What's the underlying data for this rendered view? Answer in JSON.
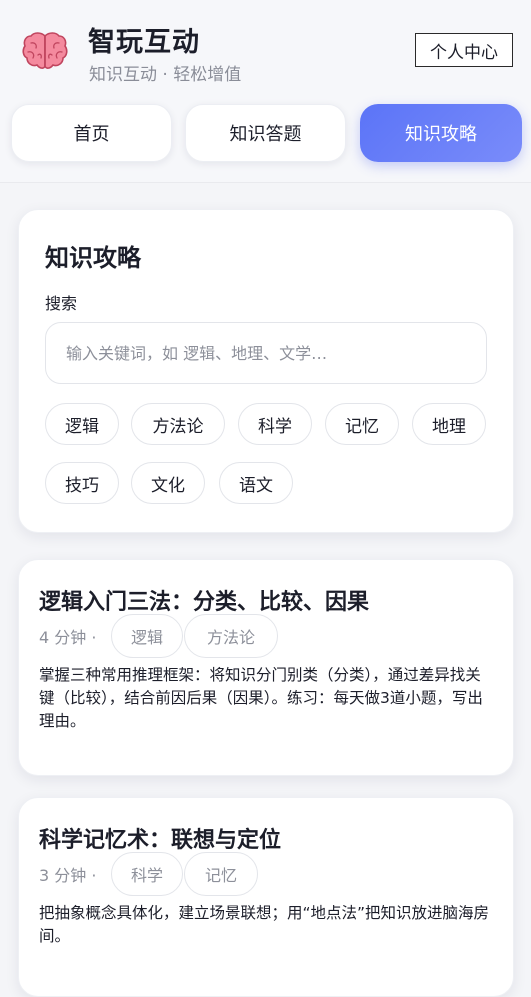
{
  "app": {
    "title": "智玩互动",
    "subtitle": "知识互动 · 轻松增值",
    "profile_label": "个人中心",
    "logo_icon": "brain-icon"
  },
  "tabs": [
    {
      "label": "首页",
      "active": false
    },
    {
      "label": "知识答题",
      "active": false
    },
    {
      "label": "知识攻略",
      "active": true
    }
  ],
  "guide": {
    "title": "知识攻略",
    "search_label": "搜索",
    "search_placeholder": "输入关键词，如 逻辑、地理、文学…",
    "search_value": "",
    "categories": [
      "逻辑",
      "方法论",
      "科学",
      "记忆",
      "地理",
      "技巧",
      "文化",
      "语文"
    ]
  },
  "articles": [
    {
      "title": "逻辑入门三法：分类、比较、因果",
      "duration": "4 分钟 ·",
      "tags": [
        "逻辑",
        "方法论"
      ],
      "body": "掌握三种常用推理框架：将知识分门别类（分类），通过差异找关键（比较），结合前因后果（因果）。练习：每天做3道小题，写出理由。"
    },
    {
      "title": "科学记忆术：联想与定位",
      "duration": "3 分钟 ·",
      "tags": [
        "科学",
        "记忆"
      ],
      "body": "把抽象概念具体化，建立场景联想；用“地点法”把知识放进脑海房间。"
    }
  ],
  "colors": {
    "accent": "#5b74f7",
    "background": "#f4f5f8",
    "card": "#ffffff",
    "muted_text": "#8d909a",
    "brain_pink": "#f48a9e"
  }
}
